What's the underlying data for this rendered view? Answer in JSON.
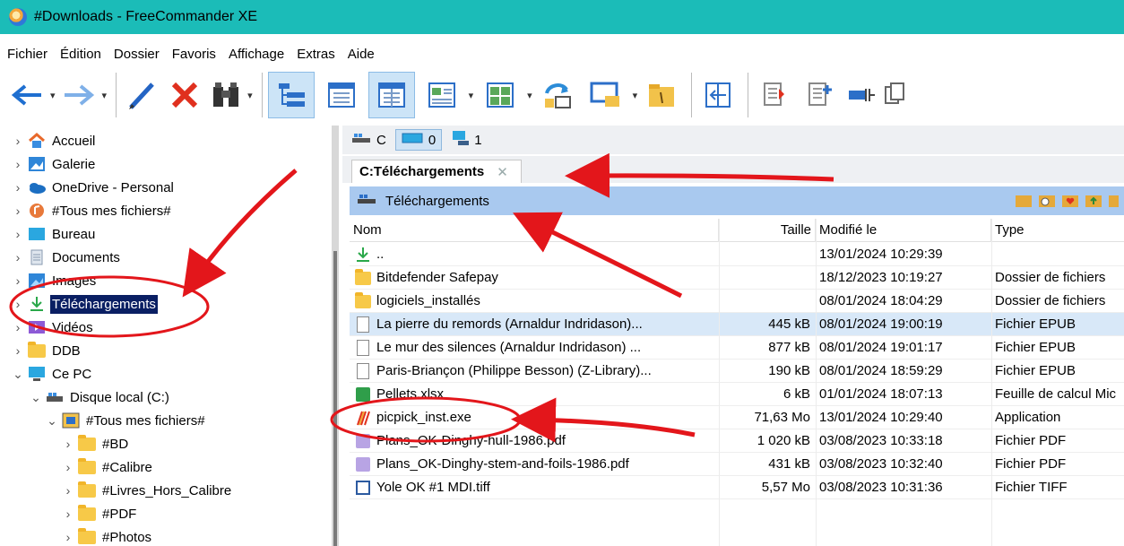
{
  "window": {
    "title": "#Downloads - FreeCommander XE"
  },
  "menu": [
    "Fichier",
    "Édition",
    "Dossier",
    "Favoris",
    "Affichage",
    "Extras",
    "Aide"
  ],
  "toolbar": {
    "icons": [
      "back-arrow-icon",
      "forward-arrow-icon",
      "edit-pencil-icon",
      "delete-x-icon",
      "search-binoculars-icon",
      "tree-view-icon",
      "single-panel-icon",
      "dual-panel-icon",
      "thumbnail-view-icon",
      "thumbnail-large-icon",
      "swap-panels-icon",
      "desktop-icon",
      "folder-icon",
      "compare-icon",
      "copy-icon",
      "new-file-icon",
      "move-icon",
      "sync-icon"
    ]
  },
  "tree": [
    {
      "label": "Accueil",
      "icon": "home-icon",
      "level": 0,
      "state": "collapsed"
    },
    {
      "label": "Galerie",
      "icon": "gallery-icon",
      "level": 0,
      "state": "collapsed"
    },
    {
      "label": "OneDrive - Personal",
      "icon": "cloud-icon",
      "level": 0,
      "state": "collapsed"
    },
    {
      "label": "#Tous mes fichiers#",
      "icon": "music-icon",
      "level": 0,
      "state": "collapsed"
    },
    {
      "label": "Bureau",
      "icon": "desktop-icon",
      "level": 0,
      "state": "collapsed"
    },
    {
      "label": "Documents",
      "icon": "document-icon",
      "level": 0,
      "state": "collapsed"
    },
    {
      "label": "Images",
      "icon": "image-icon",
      "level": 0,
      "state": "collapsed"
    },
    {
      "label": "Téléchargements",
      "icon": "download-icon",
      "level": 0,
      "state": "collapsed",
      "selected": true
    },
    {
      "label": "Vidéos",
      "icon": "video-icon",
      "level": 0,
      "state": "collapsed"
    },
    {
      "label": "DDB",
      "icon": "folder-icon",
      "level": 0,
      "state": "collapsed"
    },
    {
      "label": "Ce PC",
      "icon": "computer-icon",
      "level": 0,
      "state": "expanded"
    },
    {
      "label": "Disque local (C:)",
      "icon": "drive-icon",
      "level": 1,
      "state": "expanded"
    },
    {
      "label": "#Tous mes fichiers#",
      "icon": "shortcut-icon",
      "level": 2,
      "state": "expanded"
    },
    {
      "label": "#BD",
      "icon": "folder-icon",
      "level": 3,
      "state": "collapsed"
    },
    {
      "label": "#Calibre",
      "icon": "folder-icon",
      "level": 3,
      "state": "collapsed"
    },
    {
      "label": "#Livres_Hors_Calibre",
      "icon": "folder-icon",
      "level": 3,
      "state": "collapsed"
    },
    {
      "label": "#PDF",
      "icon": "folder-icon",
      "level": 3,
      "state": "collapsed"
    },
    {
      "label": "#Photos",
      "icon": "folder-icon",
      "level": 3,
      "state": "collapsed"
    }
  ],
  "drives": [
    {
      "label": "C",
      "icon": "drive-icon"
    },
    {
      "label": "0",
      "icon": "monitor-icon",
      "selected": true
    },
    {
      "label": "1",
      "icon": "network-icon"
    }
  ],
  "tab": {
    "label": "C:Téléchargements",
    "close": "✕"
  },
  "path": {
    "label": "Téléchargements"
  },
  "columns": {
    "name": "Nom",
    "size": "Taille",
    "date": "Modifié le",
    "type": "Type"
  },
  "files": [
    {
      "name": "..",
      "size": "",
      "date": "13/01/2024 10:29:39",
      "type": "",
      "icon": "up-arrow-icon"
    },
    {
      "name": "Bitdefender Safepay",
      "size": "",
      "date": "18/12/2023 10:19:27",
      "type": "Dossier de fichiers",
      "icon": "folder-icon"
    },
    {
      "name": "logiciels_installés",
      "size": "",
      "date": "08/01/2024 18:04:29",
      "type": "Dossier de fichiers",
      "icon": "folder-icon"
    },
    {
      "name": "La pierre du remords (Arnaldur Indridason)...",
      "size": "445 kB",
      "date": "08/01/2024 19:00:19",
      "type": "Fichier EPUB",
      "icon": "document-icon",
      "highlight": true
    },
    {
      "name": "Le mur des silences (Arnaldur Indridason) ...",
      "size": "877 kB",
      "date": "08/01/2024 19:01:17",
      "type": "Fichier EPUB",
      "icon": "document-icon"
    },
    {
      "name": "Paris-Briançon (Philippe Besson) (Z-Library)...",
      "size": "190 kB",
      "date": "08/01/2024 18:59:29",
      "type": "Fichier EPUB",
      "icon": "document-icon"
    },
    {
      "name": "Pellets.xlsx",
      "size": "6 kB",
      "date": "01/01/2024 18:07:13",
      "type": "Feuille de calcul Mic",
      "icon": "spreadsheet-icon"
    },
    {
      "name": "picpick_inst.exe",
      "size": "71,63 Mo",
      "date": "13/01/2024 10:29:40",
      "type": "Application",
      "icon": "picpick-icon"
    },
    {
      "name": "Plans_OK-Dinghy-hull-1986.pdf",
      "size": "1 020 kB",
      "date": "03/08/2023 10:33:18",
      "type": "Fichier PDF",
      "icon": "pdf-icon"
    },
    {
      "name": "Plans_OK-Dinghy-stem-and-foils-1986.pdf",
      "size": "431 kB",
      "date": "03/08/2023 10:32:40",
      "type": "Fichier PDF",
      "icon": "pdf-icon"
    },
    {
      "name": "Yole OK #1 MDI.tiff",
      "size": "5,57 Mo",
      "date": "03/08/2023 10:31:36",
      "type": "Fichier TIFF",
      "icon": "tiff-icon"
    }
  ],
  "colors": {
    "titlebar": "#1bbcb8",
    "selection": "#0a1f63",
    "pathbar": "#a9c9ef",
    "annotation": "#e3161b"
  }
}
